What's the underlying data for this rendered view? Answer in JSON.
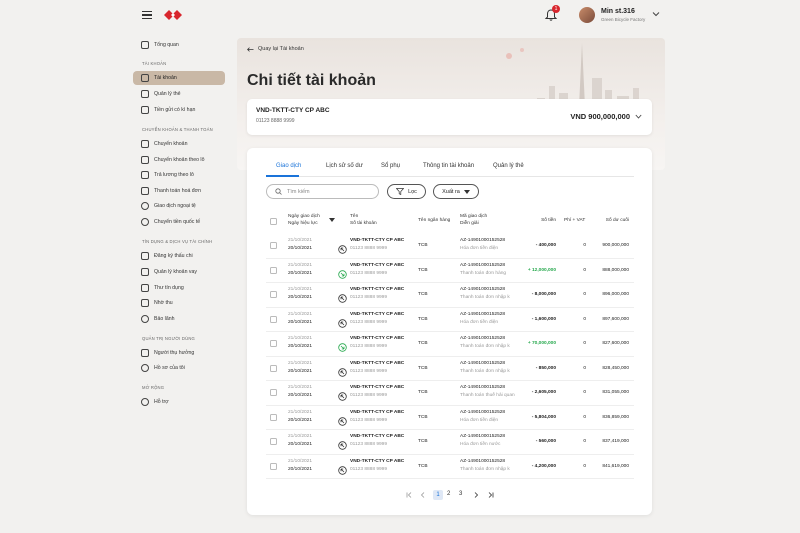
{
  "header": {
    "user_name": "Min st.316",
    "user_company": "Green Bicycle Factory",
    "notification_count": "1"
  },
  "sidebar": {
    "overview": "Tổng quan",
    "sections": {
      "account": "TÀI KHOẢN",
      "transfer": "CHUYỂN KHOẢN & THANH TOÁN",
      "credit": "TÍN DỤNG & DỊCH VỤ TÀI CHÍNH",
      "users": "QUẢN TRỊ NGƯỜI DÙNG",
      "extension": "MỞ RỘNG"
    },
    "items": {
      "accounts": "Tài khoản",
      "cards": "Quản lý thẻ",
      "deposits": "Tiền gửi có kì hạn",
      "transfer": "Chuyển khoản",
      "batch_transfer": "Chuyển khoản theo lô",
      "payroll": "Trả lương theo lô",
      "bill_pay": "Thanh toán hoá đơn",
      "fx": "Giao dịch ngoại tệ",
      "intl_transfer": "Chuyển tiền quốc tế",
      "overdraft": "Đăng ký thấu chi",
      "loans": "Quản lý khoản vay",
      "credit_letter": "Thư tín dụng",
      "collection": "Nhờ thu",
      "guarantee": "Bảo lãnh",
      "beneficiaries": "Người thụ hưởng",
      "profile": "Hồ sơ của tôi",
      "support": "Hỗ trợ"
    }
  },
  "page": {
    "back_label": "Quay lại Tài khoản",
    "title": "Chi tiết tài khoản"
  },
  "account": {
    "name": "VND-TKTT-CTY CP ABC",
    "number": "01123 8888 9999",
    "balance": "VND 900,000,000"
  },
  "tabs": [
    "Giao dịch",
    "Lịch sử số dư",
    "Sổ phụ",
    "Thông tin tài khoản",
    "Quản lý thẻ"
  ],
  "toolbar": {
    "search_placeholder": "Tìm kiếm",
    "filter_label": "Lọc",
    "export_label": "Xuất ra"
  },
  "table": {
    "headers": {
      "date_1": "Ngày giao dịch",
      "date_2": "Ngày hiệu lực",
      "name_1": "Tên",
      "name_2": "Số tài khoản",
      "bank": "Tên ngân hàng",
      "code_1": "Mã giao dịch",
      "code_2": "Diễn giải",
      "amount": "Số tiền",
      "fee": "Phí + VAT",
      "balance": "Số dư cuối"
    },
    "rows": [
      {
        "date1": "21/10/2021",
        "date2": "20/10/2021",
        "name": "VND-TKTT-CTY CP ABC",
        "acct": "01123 8888 9999",
        "bank": "TCB",
        "code": "AZ-14901000152528",
        "desc": "Hóa đơn tiền điện",
        "amount": "- 400,000",
        "type": "out",
        "fee": "0",
        "balance": "900,000,000"
      },
      {
        "date1": "21/10/2021",
        "date2": "20/10/2021",
        "name": "VND-TKTT-CTY CP ABC",
        "acct": "01123 8888 9999",
        "bank": "TCB",
        "code": "AZ-14901000152528",
        "desc": "Thanh toán đơn hàng",
        "amount": "+ 12,000,000",
        "type": "in",
        "fee": "0",
        "balance": "888,000,000"
      },
      {
        "date1": "21/10/2021",
        "date2": "20/10/2021",
        "name": "VND-TKTT-CTY CP ABC",
        "acct": "01123 8888 9999",
        "bank": "TCB",
        "code": "AZ-14901000152528",
        "desc": "Thanh toán đơn nhập k",
        "amount": "- 8,000,000",
        "type": "out",
        "fee": "0",
        "balance": "896,000,000"
      },
      {
        "date1": "21/10/2021",
        "date2": "20/10/2021",
        "name": "VND-TKTT-CTY CP ABC",
        "acct": "01123 8888 9999",
        "bank": "TCB",
        "code": "AZ-14901000152528",
        "desc": "Hóa đơn tiền điện",
        "amount": "- 1,600,000",
        "type": "out",
        "fee": "0",
        "balance": "897,600,000"
      },
      {
        "date1": "21/10/2021",
        "date2": "20/10/2021",
        "name": "VND-TKTT-CTY CP ABC",
        "acct": "01123 8888 9999",
        "bank": "TCB",
        "code": "AZ-14901000152528",
        "desc": "Thanh toán đơn nhập k",
        "amount": "+ 70,000,000",
        "type": "in",
        "fee": "0",
        "balance": "827,600,000"
      },
      {
        "date1": "21/10/2021",
        "date2": "20/10/2021",
        "name": "VND-TKTT-CTY CP ABC",
        "acct": "01123 8888 9999",
        "bank": "TCB",
        "code": "AZ-14901000152528",
        "desc": "Thanh toán đơn nhập k",
        "amount": "- 850,000",
        "type": "out",
        "fee": "0",
        "balance": "828,450,000"
      },
      {
        "date1": "21/10/2021",
        "date2": "20/10/2021",
        "name": "VND-TKTT-CTY CP ABC",
        "acct": "01123 8888 9999",
        "bank": "TCB",
        "code": "AZ-14901000152528",
        "desc": "Thanh toán thuế hải quan",
        "amount": "- 2,605,000",
        "type": "out",
        "fee": "0",
        "balance": "831,055,000"
      },
      {
        "date1": "21/10/2021",
        "date2": "20/10/2021",
        "name": "VND-TKTT-CTY CP ABC",
        "acct": "01123 8888 9999",
        "bank": "TCB",
        "code": "AZ-14901000152528",
        "desc": "Hóa đơn tiền điện",
        "amount": "- 5,804,000",
        "type": "out",
        "fee": "0",
        "balance": "836,859,000"
      },
      {
        "date1": "21/10/2021",
        "date2": "20/10/2021",
        "name": "VND-TKTT-CTY CP ABC",
        "acct": "01123 8888 9999",
        "bank": "TCB",
        "code": "AZ-14901000152528",
        "desc": "Hóa đơn tiền nước",
        "amount": "- 560,000",
        "type": "out",
        "fee": "0",
        "balance": "837,419,000"
      },
      {
        "date1": "21/10/2021",
        "date2": "20/10/2021",
        "name": "VND-TKTT-CTY CP ABC",
        "acct": "01123 8888 9999",
        "bank": "TCB",
        "code": "AZ-14901000152528",
        "desc": "Thanh toán đơn nhập k",
        "amount": "- 4,200,000",
        "type": "out",
        "fee": "0",
        "balance": "841,619,000"
      }
    ]
  },
  "pagination": {
    "pages": [
      "1",
      "2",
      "3"
    ],
    "current": "1"
  },
  "colors": {
    "accent": "#1a73d9",
    "positive": "#25a84c",
    "brand": "#d8262d",
    "active_nav": "#c9b8a6"
  }
}
